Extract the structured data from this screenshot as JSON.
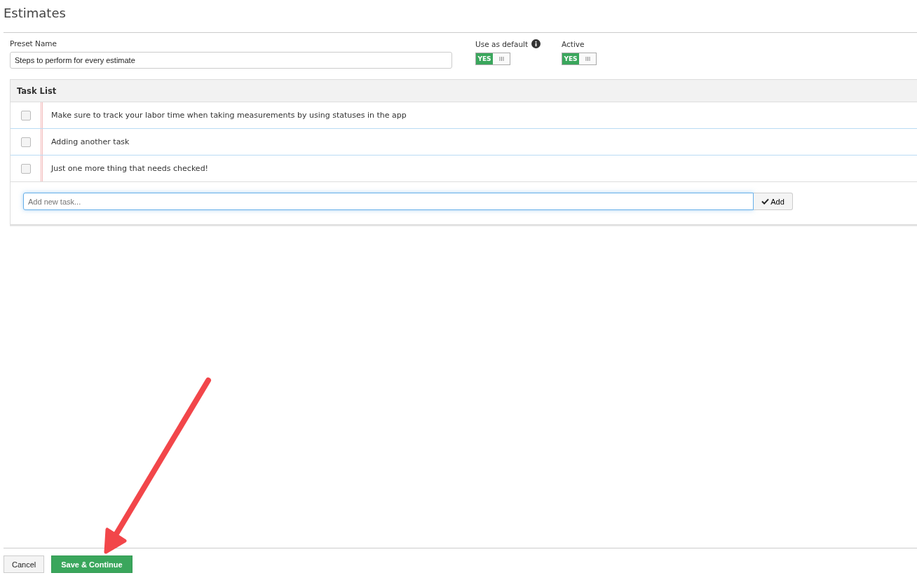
{
  "page": {
    "title": "Estimates"
  },
  "preset_name": {
    "label": "Preset Name",
    "value": "Steps to perform for every estimate"
  },
  "toggles": [
    {
      "label": "Use as default",
      "info_icon": true,
      "on": true,
      "on_text": "YES"
    },
    {
      "label": "Active",
      "info_icon": false,
      "on": true,
      "on_text": "YES"
    }
  ],
  "task_list": {
    "title": "Task List",
    "tasks": [
      {
        "text": "Make sure to track your labor time when taking measurements by using statuses in the app",
        "checked": false
      },
      {
        "text": "Adding another task",
        "checked": false
      },
      {
        "text": "Just one more thing that needs checked!",
        "checked": false
      }
    ],
    "new_task": {
      "placeholder": "Add new task...",
      "button": "Add"
    }
  },
  "footer_buttons": [
    {
      "label": "Cancel",
      "kind": "default"
    },
    {
      "label": "Save & Continue",
      "kind": "primary"
    }
  ]
}
